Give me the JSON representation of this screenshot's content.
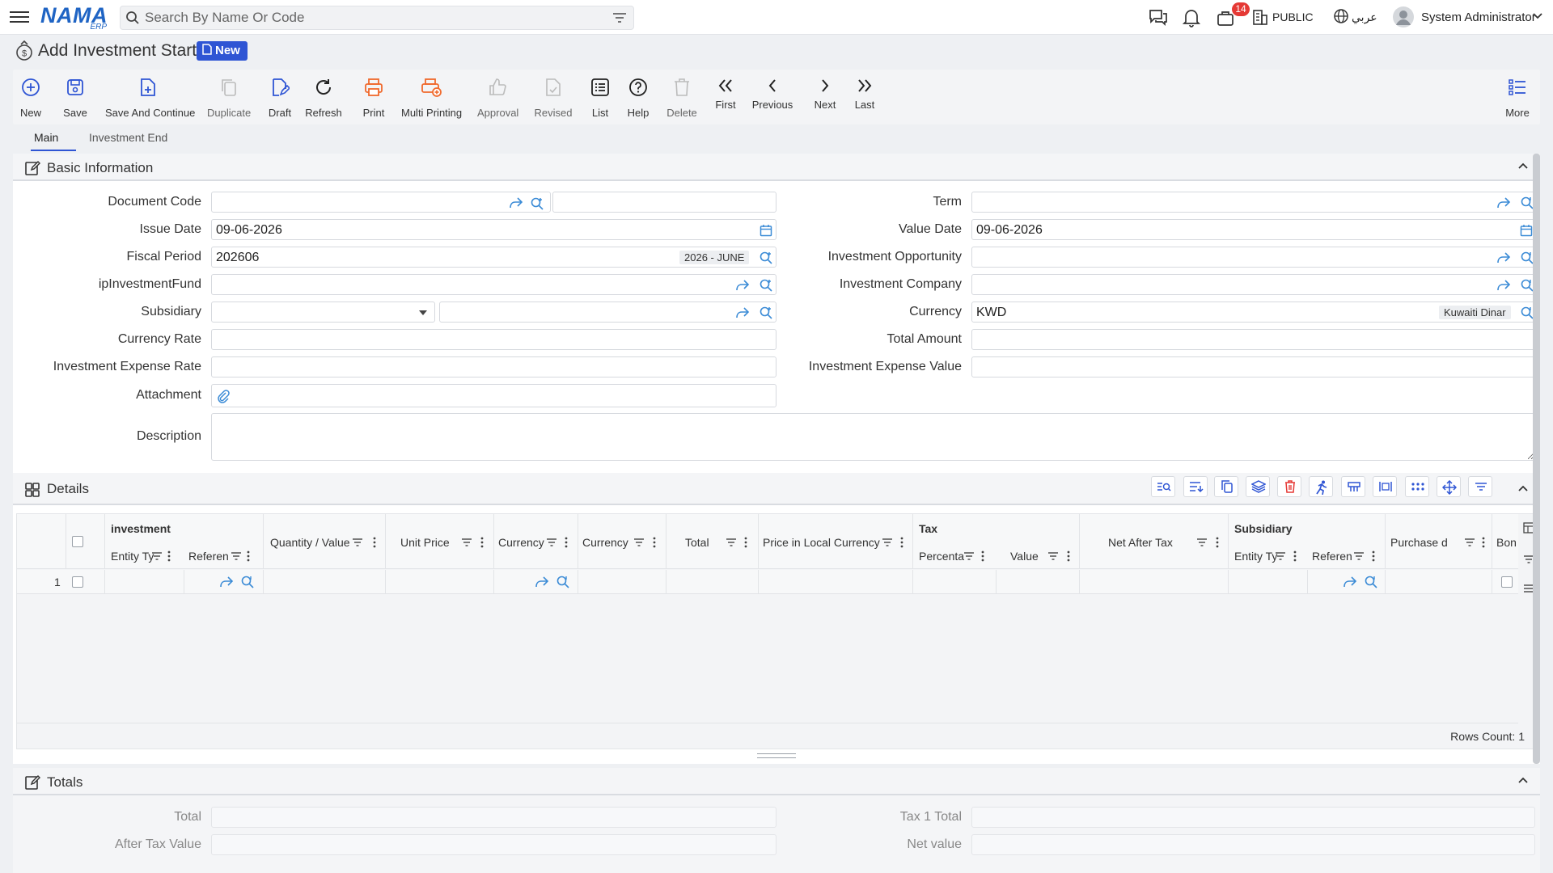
{
  "app": {
    "logo": "NAMA",
    "logo_sub": "ERP",
    "search_placeholder": "Search By Name Or Code",
    "notifications_count": "14",
    "branch": "PUBLIC",
    "language": "عربي",
    "user": "System Administrator"
  },
  "page": {
    "title": "Add Investment Start",
    "badge": "New"
  },
  "toolbar": {
    "new": "New",
    "save": "Save",
    "save_continue": "Save And Continue",
    "duplicate": "Duplicate",
    "draft": "Draft",
    "refresh": "Refresh",
    "print": "Print",
    "multi_printing": "Multi Printing",
    "approval": "Approval",
    "revised": "Revised",
    "list": "List",
    "help": "Help",
    "delete": "Delete",
    "first": "First",
    "previous": "Previous",
    "next": "Next",
    "last": "Last",
    "more": "More"
  },
  "tabs": [
    "Main",
    "Investment End"
  ],
  "basic": {
    "title": "Basic Information",
    "labels": {
      "document_code": "Document Code",
      "issue_date": "Issue Date",
      "fiscal_period": "Fiscal Period",
      "fund": "ipInvestmentFund",
      "subsidiary": "Subsidiary",
      "currency_rate": "Currency Rate",
      "expense_rate": "Investment Expense Rate",
      "attachment": "Attachment",
      "description": "Description",
      "term": "Term",
      "value_date": "Value Date",
      "opportunity": "Investment Opportunity",
      "company": "Investment Company",
      "currency": "Currency",
      "total_amount": "Total Amount",
      "expense_value": "Investment Expense Value"
    },
    "values": {
      "issue_date": "09-06-2026",
      "fiscal_period": "202606",
      "fiscal_period_name": "2026 - JUNE",
      "value_date": "09-06-2026",
      "currency": "KWD",
      "currency_name": "Kuwaiti Dinar"
    }
  },
  "details": {
    "title": "Details",
    "groups": {
      "investment": "investment",
      "tax": "Tax",
      "subsidiary": "Subsidiary"
    },
    "columns": {
      "entity_type": "Entity Ty",
      "reference": "Referen",
      "quantity": "Quantity / Value",
      "unit_price": "Unit Price",
      "currency1": "Currency",
      "currency2": "Currency",
      "total": "Total",
      "price_local": "Price in Local Currency",
      "percentage": "Percenta",
      "value": "Value",
      "net_after_tax": "Net After Tax",
      "sub_entity_type": "Entity Ty",
      "sub_reference": "Referen",
      "purchase_date": "Purchase date",
      "bon": "Bon"
    },
    "rows": [
      {
        "index": "1"
      }
    ],
    "rows_count": "Rows Count: 1"
  },
  "totals": {
    "title": "Totals",
    "labels": {
      "total": "Total",
      "after_tax": "After Tax Value",
      "tax1_total": "Tax 1 Total",
      "net_value": "Net value"
    }
  },
  "colors": {
    "accent": "#2f55d4",
    "brand": "#1f64c4",
    "link_icon": "#3b8bd6",
    "print_icon": "#f0692c",
    "badge": "#e53935"
  }
}
